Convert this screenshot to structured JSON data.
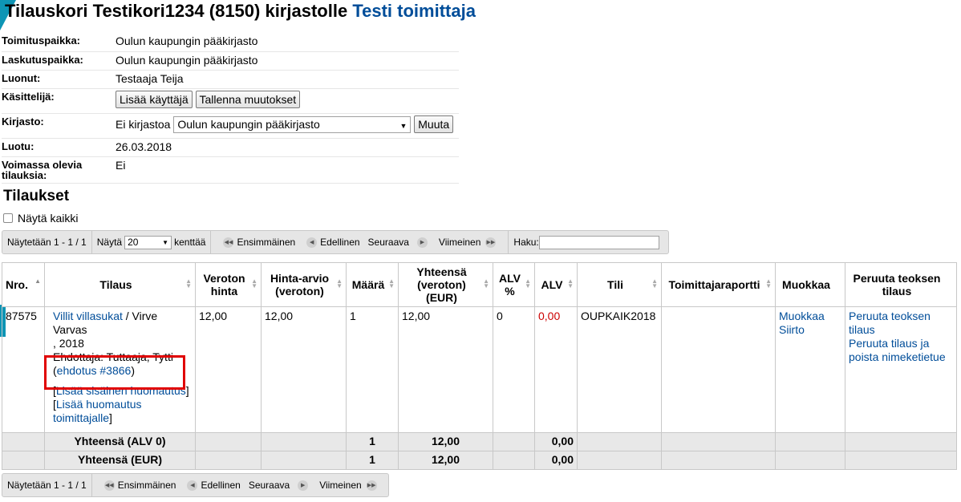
{
  "title": {
    "prefix": "Tilauskori Testikori1234 (8150) kirjastolle",
    "vendor": "Testi toimittaja"
  },
  "info": {
    "delivery_label": "Toimituspaikka:",
    "delivery_value": "Oulun kaupungin pääkirjasto",
    "billing_label": "Laskutuspaikka:",
    "billing_value": "Oulun kaupungin pääkirjasto",
    "created_by_label": "Luonut:",
    "created_by_value": "Testaaja Teija",
    "handler_label": "Käsittelijä:",
    "add_user_button": "Lisää käyttäjä",
    "save_changes_button": "Tallenna muutokset",
    "library_label": "Kirjasto:",
    "library_prefix": "Ei kirjastoa",
    "library_select": "Oulun kaupungin pääkirjasto",
    "change_button": "Muuta",
    "created_label": "Luotu:",
    "created_value": "26.03.2018",
    "standing_label": "Voimassa olevia tilauksia:",
    "standing_value": "Ei"
  },
  "orders_heading": "Tilaukset",
  "show_all_label": "Näytä kaikki",
  "pager": {
    "showing": "Näytetään 1 - 1 / 1",
    "show": "Näytä",
    "page_size": "20",
    "entries": "kenttää",
    "first": "Ensimmäinen",
    "previous": "Edellinen",
    "next": "Seuraava",
    "last": "Viimeinen",
    "search": "Haku:"
  },
  "columns": [
    "Nro.",
    "Tilaus",
    "Veroton hinta",
    "Hinta-arvio (veroton)",
    "Määrä",
    "Yhteensä (veroton) (EUR)",
    "ALV %",
    "ALV",
    "Tili",
    "Toimittajaraportti",
    "Muokkaa",
    "Peruuta teoksen tilaus"
  ],
  "order": {
    "nro": "87575",
    "title_link": "Villit villasukat",
    "author_sep": " / Virve Varvas",
    "year": ", 2018",
    "suggested_by": "Ehdottaja: Tuttaaja, Tytti",
    "suggestion_link": "ehdotus #3866",
    "internal_note": "Lisää sisäinen huomautus",
    "vendor_note": "Lisää huomautus toimittajalle",
    "price": "12,00",
    "estimate": "12,00",
    "quantity": "1",
    "total": "12,00",
    "vat_pct": "0",
    "vat": "0,00",
    "fund": "OUPKAIK2018",
    "vendor_report": "",
    "modify": "Muokkaa",
    "transfer": "Siirto",
    "cancel": "Peruuta teoksen tilaus",
    "cancel_delete": "Peruuta tilaus ja poista nimeketietue"
  },
  "totals": [
    {
      "label": "Yhteensä (ALV 0)",
      "quantity": "1",
      "total": "12,00",
      "vat": "0,00"
    },
    {
      "label": "Yhteensä (EUR)",
      "quantity": "1",
      "total": "12,00",
      "vat": "0,00"
    }
  ],
  "accent_color": "#004d99",
  "highlight_color": "#e00000"
}
